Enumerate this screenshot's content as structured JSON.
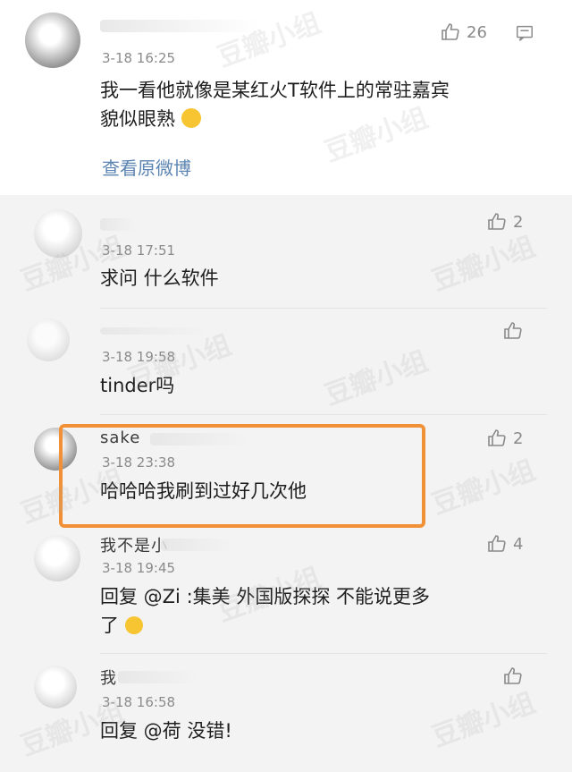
{
  "main_comment": {
    "time": "3-18 16:25",
    "text_line1": "我一看他就像是某红火T软件上的常驻嘉宾",
    "text_line2": "貌似眼熟",
    "link": "查看原微博",
    "likes": "26"
  },
  "replies": [
    {
      "name": "",
      "time": "3-18 17:51",
      "text": "求问 什么软件",
      "likes": "2"
    },
    {
      "name": "",
      "time": "3-18 19:58",
      "text": "tinder吗",
      "likes": ""
    },
    {
      "name": "sake",
      "time": "3-18 23:38",
      "text": "哈哈哈我刷到过好几次他",
      "likes": "2"
    },
    {
      "name": "我不是小",
      "time": "3-18 19:45",
      "text_line1": "回复 @Zi :集美 外国版探探 不能说更多",
      "text_line2": "了",
      "likes": "4"
    },
    {
      "name": "我",
      "time": "3-18 16:58",
      "text": "回复 @荷 没错!",
      "likes": ""
    }
  ],
  "watermark": "豆瓣小组",
  "colors": {
    "highlight": "#f19137",
    "link": "#5b84b1",
    "reply_bg": "#f3f3f3"
  }
}
